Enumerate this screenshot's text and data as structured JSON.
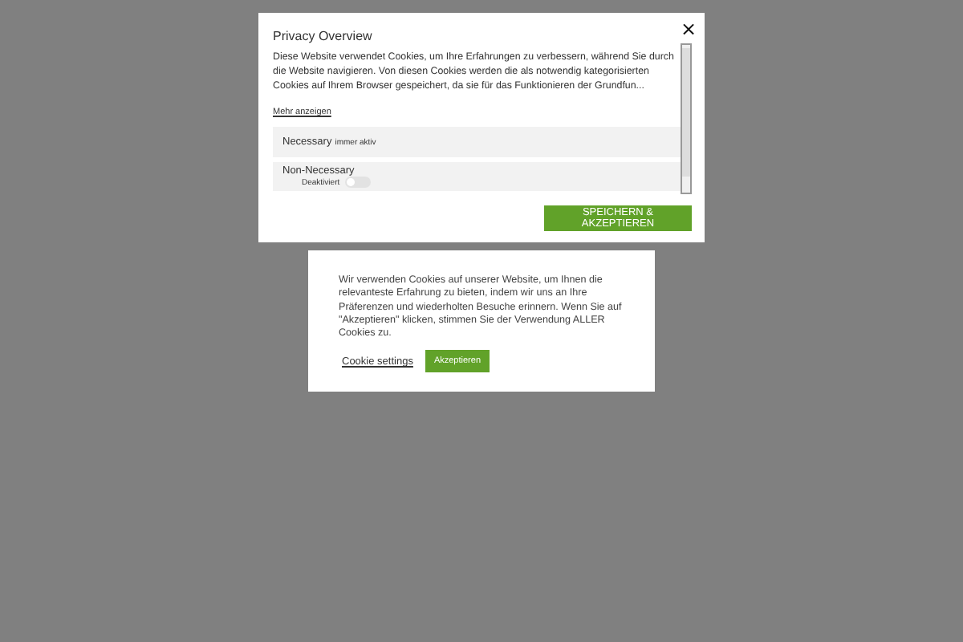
{
  "privacy_modal": {
    "title": "Privacy Overview",
    "close": "×",
    "description": "Diese Website verwendet Cookies, um Ihre Erfahrungen zu verbessern, während Sie durch die Website navigieren. Von diesen Cookies werden die als notwendig kategorisierten Cookies auf Ihrem Browser gespeichert, da sie für das Funktionieren der Grundfun...",
    "more_link": "Mehr anzeigen",
    "categories": [
      {
        "kind": "always",
        "name": "Necessary",
        "status": "immer aktiv"
      },
      {
        "kind": "toggle",
        "name": "Non-Necessary",
        "status": "Deaktiviert",
        "on": false
      }
    ],
    "save_button": "SPEICHERN & AKZEPTIEREN"
  },
  "cookie_banner": {
    "message": "Wir verwenden Cookies auf unserer Website, um Ihnen die relevanteste Erfahrung zu bieten, indem wir uns an Ihre Präferenzen und wiederholten Besuche erinnern. Wenn Sie auf \"Akzeptieren\" klicken, stimmen Sie der Verwendung ALLER Cookies zu.",
    "settings_link": "Cookie settings",
    "accept_button": "Akzeptieren"
  }
}
